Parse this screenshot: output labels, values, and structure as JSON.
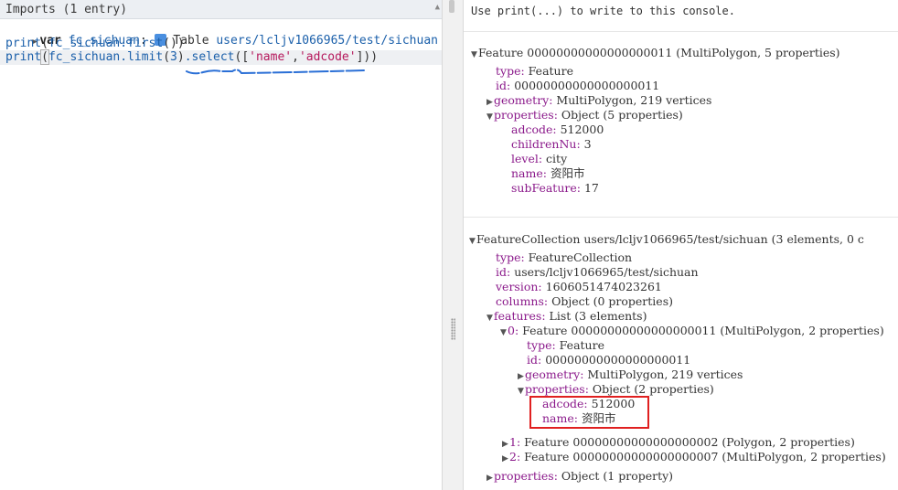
{
  "editor": {
    "imports_title": "Imports (1 entry)",
    "import_line": {
      "keyword": "var",
      "var_name": "fc_sichuan",
      "colon": ":",
      "type": "Table",
      "path": "users/lcljv1066965/test/sichuan"
    },
    "line2": {
      "fn": "print",
      "open": "(",
      "var": "fc_sichuan",
      "method": ".first",
      "close": "())"
    },
    "line3": {
      "fn": "print",
      "open": "(",
      "var": "fc_sichuan",
      "method": ".limit",
      "arg_open": "(",
      "num": "3",
      "arg_close": ")",
      "method2": ".select",
      "list_open": "([",
      "str1": "'name'",
      "comma": ",",
      "str2": "'adcode'",
      "list_close": "]))"
    }
  },
  "console": {
    "hint": "Use print(...) to write to this console.",
    "feature": {
      "header": "Feature 00000000000000000011 (MultiPolygon, 5 properties)",
      "type_k": "type:",
      "type_v": " Feature",
      "id_k": "id:",
      "id_v": " 00000000000000000011",
      "geometry_k": "geometry:",
      "geometry_v": " MultiPolygon, 219 vertices",
      "properties_k": "properties:",
      "properties_v": " Object (5 properties)",
      "adcode_k": "adcode:",
      "adcode_v": " 512000",
      "children_k": "childrenNu:",
      "children_v": " 3",
      "level_k": "level:",
      "level_v": " city",
      "name_k": "name:",
      "name_v": " 资阳市",
      "subfeature_k": "subFeature:",
      "subfeature_v": " 17"
    },
    "collection": {
      "header": "FeatureCollection users/lcljv1066965/test/sichuan (3 elements, 0 c",
      "type_k": "type:",
      "type_v": " FeatureCollection",
      "id_k": "id:",
      "id_v": " users/lcljv1066965/test/sichuan",
      "version_k": "version:",
      "version_v": " 1606051474023261",
      "columns_k": "columns:",
      "columns_v": " Object (0 properties)",
      "features_k": "features:",
      "features_v": " List (3 elements)",
      "f0_k": "0:",
      "f0_v": " Feature 00000000000000000011 (MultiPolygon, 2 properties)",
      "f0_type_k": "type:",
      "f0_type_v": " Feature",
      "f0_id_k": "id:",
      "f0_id_v": " 00000000000000000011",
      "f0_geometry_k": "geometry:",
      "f0_geometry_v": " MultiPolygon, 219 vertices",
      "f0_properties_k": "properties:",
      "f0_properties_v": " Object (2 properties)",
      "f0_adcode_k": "adcode:",
      "f0_adcode_v": " 512000",
      "f0_name_k": "name:",
      "f0_name_v": " 资阳市",
      "f1_k": "1:",
      "f1_v": " Feature 00000000000000000002 (Polygon, 2 properties)",
      "f2_k": "2:",
      "f2_v": " Feature 00000000000000000007 (MultiPolygon, 2 properties)",
      "props_k": "properties:",
      "props_v": " Object (1 property)"
    }
  },
  "colors": {
    "highlight_box": "#e02020",
    "property_key": "#8b1a8b",
    "code_identifier": "#1a5faa",
    "code_string": "#b5175b"
  }
}
